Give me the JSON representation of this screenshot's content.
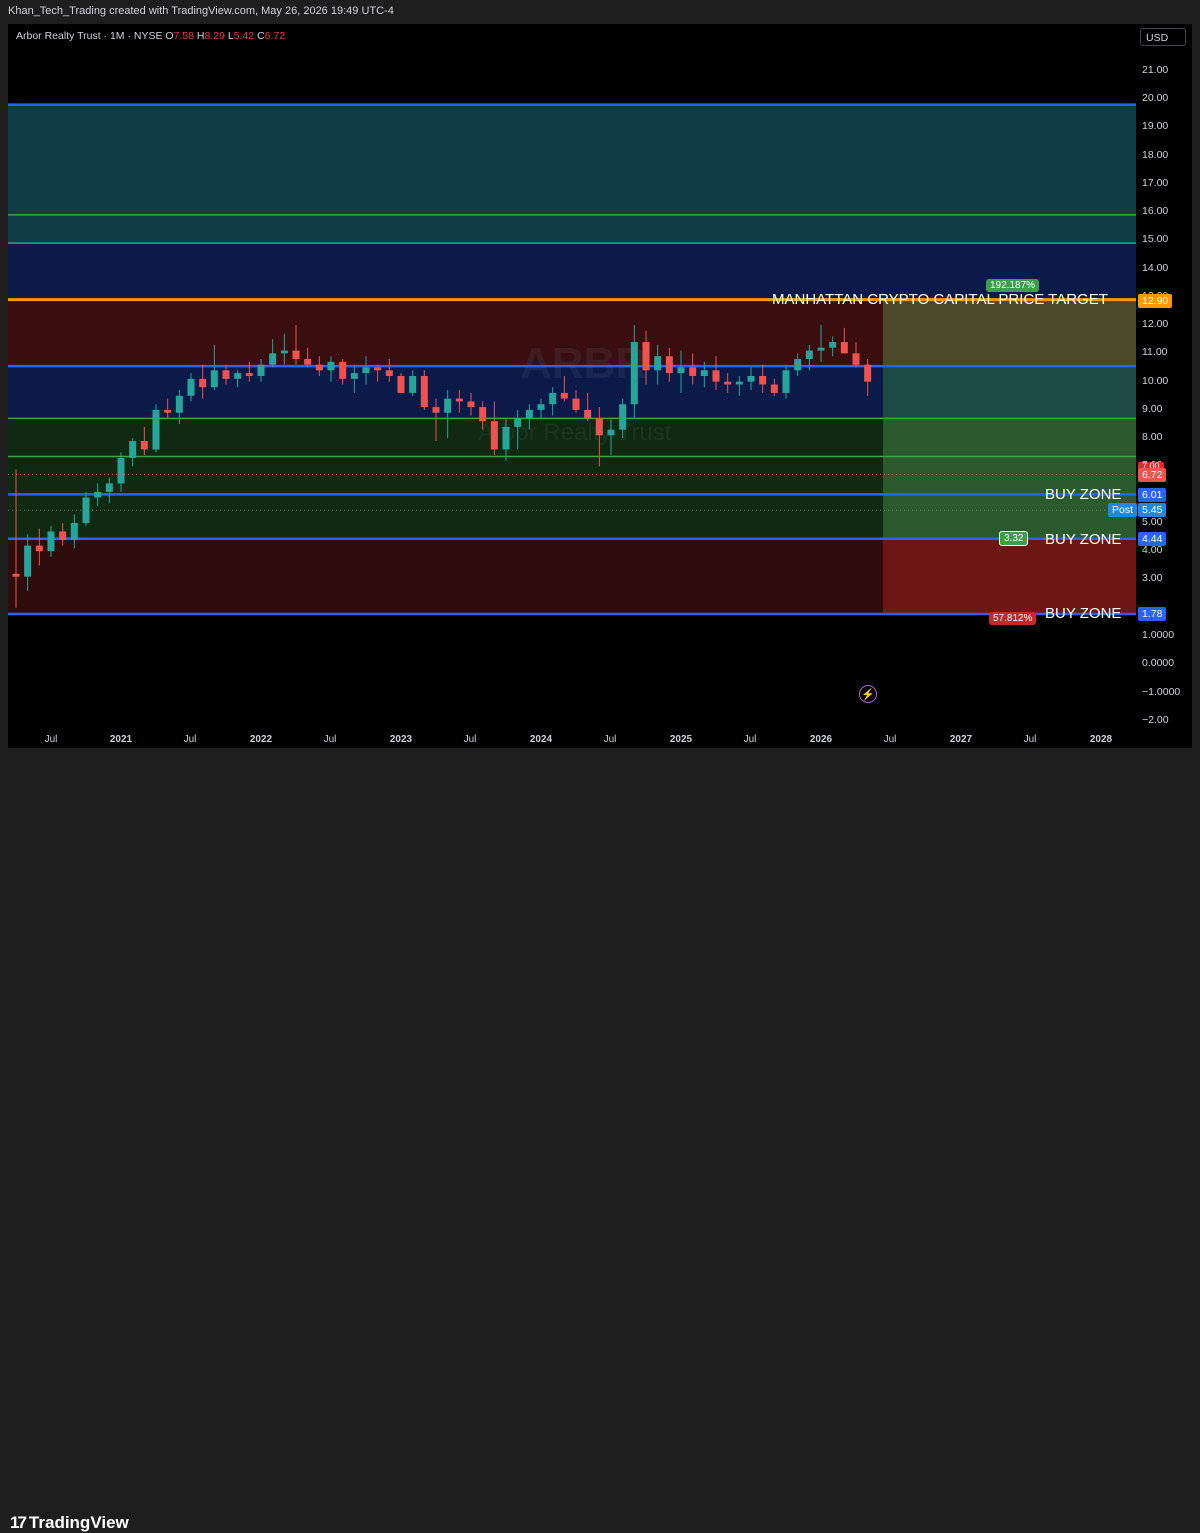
{
  "header": {
    "attribution": "Khan_Tech_Trading created with TradingView.com, May 26, 2026 19:49 UTC-4"
  },
  "legend": {
    "title": "Arbor Realty Trust · 1M · NYSE",
    "o": "7.58",
    "h": "8.29",
    "l": "5.42",
    "c": "6.72"
  },
  "currency": "USD",
  "watermark": {
    "ticker": "ARBR",
    "name": "Arbor Realty Trust"
  },
  "footer": {
    "brand": "TradingView"
  },
  "colors": {
    "up": "#26a69a",
    "down": "#ef5350",
    "blue_line": "#2962ff",
    "orange_line": "#ff9800",
    "green_line": "#43a047"
  },
  "annotations": {
    "target_label": "MANHATTAN CRYPTO CAPITAL PRICE TARGET",
    "buy_zone_1": "BUY ZONE",
    "buy_zone_2": "BUY ZONE",
    "buy_zone_3": "BUY ZONE",
    "gain_pct": "192.187%",
    "loss_pct": "57.812%",
    "ratio": "3.32"
  },
  "price_tags": {
    "target": "12.90",
    "last": "6.72",
    "buy1": "6.01",
    "post_label": "Post",
    "post_value": "5.45",
    "buy2": "4.44",
    "buy3": "1.78",
    "partial": "7.00"
  },
  "chart_data": {
    "type": "candlestick",
    "title": "Arbor Realty Trust · 1M · NYSE",
    "y_ticks": [
      "21.00",
      "20.00",
      "19.00",
      "18.00",
      "17.00",
      "16.00",
      "15.00",
      "14.00",
      "13.00",
      "12.00",
      "11.00",
      "10.00",
      "9.00",
      "8.00",
      "7.00",
      "5.00",
      "4.00",
      "3.00",
      "1.0000",
      "0.0000",
      "−1.0000",
      "−2.00"
    ],
    "x_ticks": [
      "Jul",
      "2021",
      "Jul",
      "2022",
      "Jul",
      "2023",
      "Jul",
      "2024",
      "Jul",
      "2025",
      "Jul",
      "2026",
      "Jul",
      "2027",
      "Jul",
      "2028"
    ],
    "ylim": [
      -2.2,
      22.3
    ],
    "horizontal_levels": [
      {
        "price": 19.8,
        "style": "blue"
      },
      {
        "price": 15.9,
        "style": "green"
      },
      {
        "price": 14.9,
        "style": "teal"
      },
      {
        "price": 12.9,
        "style": "orange"
      },
      {
        "price": 10.55,
        "style": "blue"
      },
      {
        "price": 8.7,
        "style": "green"
      },
      {
        "price": 7.35,
        "style": "green"
      },
      {
        "price": 6.01,
        "style": "blue"
      },
      {
        "price": 4.44,
        "style": "blue"
      },
      {
        "price": 1.78,
        "style": "blue"
      }
    ],
    "candles": [
      {
        "t": "2020-04",
        "o": 3.2,
        "h": 6.9,
        "l": 2.0,
        "c": 3.1
      },
      {
        "t": "2020-05",
        "o": 3.1,
        "h": 4.6,
        "l": 2.6,
        "c": 4.2
      },
      {
        "t": "2020-06",
        "o": 4.2,
        "h": 4.8,
        "l": 3.5,
        "c": 4.0
      },
      {
        "t": "2020-07",
        "o": 4.0,
        "h": 4.9,
        "l": 3.8,
        "c": 4.7
      },
      {
        "t": "2020-08",
        "o": 4.7,
        "h": 5.0,
        "l": 4.2,
        "c": 4.4
      },
      {
        "t": "2020-09",
        "o": 4.4,
        "h": 5.3,
        "l": 4.1,
        "c": 5.0
      },
      {
        "t": "2020-10",
        "o": 5.0,
        "h": 6.1,
        "l": 4.9,
        "c": 5.9
      },
      {
        "t": "2020-11",
        "o": 5.9,
        "h": 6.4,
        "l": 5.6,
        "c": 6.1
      },
      {
        "t": "2020-12",
        "o": 6.1,
        "h": 6.6,
        "l": 5.7,
        "c": 6.4
      },
      {
        "t": "2021-01",
        "o": 6.4,
        "h": 7.5,
        "l": 6.1,
        "c": 7.3
      },
      {
        "t": "2021-02",
        "o": 7.3,
        "h": 8.0,
        "l": 7.0,
        "c": 7.9
      },
      {
        "t": "2021-03",
        "o": 7.9,
        "h": 8.4,
        "l": 7.4,
        "c": 7.6
      },
      {
        "t": "2021-04",
        "o": 7.6,
        "h": 9.2,
        "l": 7.5,
        "c": 9.0
      },
      {
        "t": "2021-05",
        "o": 9.0,
        "h": 9.4,
        "l": 8.7,
        "c": 8.9
      },
      {
        "t": "2021-06",
        "o": 8.9,
        "h": 9.7,
        "l": 8.5,
        "c": 9.5
      },
      {
        "t": "2021-07",
        "o": 9.5,
        "h": 10.3,
        "l": 9.3,
        "c": 10.1
      },
      {
        "t": "2021-08",
        "o": 10.1,
        "h": 10.6,
        "l": 9.4,
        "c": 9.8
      },
      {
        "t": "2021-09",
        "o": 9.8,
        "h": 11.3,
        "l": 9.7,
        "c": 10.4
      },
      {
        "t": "2021-10",
        "o": 10.4,
        "h": 10.6,
        "l": 9.9,
        "c": 10.1
      },
      {
        "t": "2021-11",
        "o": 10.1,
        "h": 10.4,
        "l": 9.8,
        "c": 10.3
      },
      {
        "t": "2021-12",
        "o": 10.3,
        "h": 10.7,
        "l": 10.0,
        "c": 10.2
      },
      {
        "t": "2022-01",
        "o": 10.2,
        "h": 10.8,
        "l": 10.0,
        "c": 10.6
      },
      {
        "t": "2022-02",
        "o": 10.6,
        "h": 11.5,
        "l": 10.5,
        "c": 11.0
      },
      {
        "t": "2022-03",
        "o": 11.0,
        "h": 11.7,
        "l": 10.6,
        "c": 11.1
      },
      {
        "t": "2022-04",
        "o": 11.1,
        "h": 12.0,
        "l": 10.6,
        "c": 10.8
      },
      {
        "t": "2022-05",
        "o": 10.8,
        "h": 11.2,
        "l": 10.5,
        "c": 10.6
      },
      {
        "t": "2022-06",
        "o": 10.6,
        "h": 10.9,
        "l": 10.2,
        "c": 10.4
      },
      {
        "t": "2022-07",
        "o": 10.4,
        "h": 10.9,
        "l": 10.0,
        "c": 10.7
      },
      {
        "t": "2022-08",
        "o": 10.7,
        "h": 10.8,
        "l": 9.9,
        "c": 10.1
      },
      {
        "t": "2022-09",
        "o": 10.1,
        "h": 10.6,
        "l": 9.6,
        "c": 10.3
      },
      {
        "t": "2022-10",
        "o": 10.3,
        "h": 10.9,
        "l": 9.9,
        "c": 10.5
      },
      {
        "t": "2022-11",
        "o": 10.5,
        "h": 10.6,
        "l": 10.0,
        "c": 10.4
      },
      {
        "t": "2022-12",
        "o": 10.4,
        "h": 10.8,
        "l": 10.0,
        "c": 10.2
      },
      {
        "t": "2023-01",
        "o": 10.2,
        "h": 10.3,
        "l": 9.6,
        "c": 9.6
      },
      {
        "t": "2023-02",
        "o": 9.6,
        "h": 10.4,
        "l": 9.5,
        "c": 10.2
      },
      {
        "t": "2023-03",
        "o": 10.2,
        "h": 10.4,
        "l": 9.0,
        "c": 9.1
      },
      {
        "t": "2023-04",
        "o": 9.1,
        "h": 9.4,
        "l": 7.9,
        "c": 8.9
      },
      {
        "t": "2023-05",
        "o": 8.9,
        "h": 9.7,
        "l": 8.0,
        "c": 9.4
      },
      {
        "t": "2023-06",
        "o": 9.4,
        "h": 9.7,
        "l": 8.9,
        "c": 9.3
      },
      {
        "t": "2023-07",
        "o": 9.3,
        "h": 9.6,
        "l": 8.8,
        "c": 9.1
      },
      {
        "t": "2023-08",
        "o": 9.1,
        "h": 9.3,
        "l": 8.3,
        "c": 8.6
      },
      {
        "t": "2023-09",
        "o": 8.6,
        "h": 9.3,
        "l": 7.4,
        "c": 7.6
      },
      {
        "t": "2023-10",
        "o": 7.6,
        "h": 8.7,
        "l": 7.2,
        "c": 8.4
      },
      {
        "t": "2023-11",
        "o": 8.4,
        "h": 9.0,
        "l": 7.6,
        "c": 8.7
      },
      {
        "t": "2023-12",
        "o": 8.7,
        "h": 9.2,
        "l": 8.3,
        "c": 9.0
      },
      {
        "t": "2024-01",
        "o": 9.0,
        "h": 9.4,
        "l": 8.7,
        "c": 9.2
      },
      {
        "t": "2024-02",
        "o": 9.2,
        "h": 9.8,
        "l": 8.8,
        "c": 9.6
      },
      {
        "t": "2024-03",
        "o": 9.6,
        "h": 10.2,
        "l": 9.3,
        "c": 9.4
      },
      {
        "t": "2024-04",
        "o": 9.4,
        "h": 9.7,
        "l": 8.9,
        "c": 9.0
      },
      {
        "t": "2024-05",
        "o": 9.0,
        "h": 9.6,
        "l": 8.6,
        "c": 8.7
      },
      {
        "t": "2024-06",
        "o": 8.7,
        "h": 9.1,
        "l": 7.0,
        "c": 8.1
      },
      {
        "t": "2024-07",
        "o": 8.1,
        "h": 8.7,
        "l": 7.4,
        "c": 8.3
      },
      {
        "t": "2024-08",
        "o": 8.3,
        "h": 9.4,
        "l": 8.0,
        "c": 9.2
      },
      {
        "t": "2024-09",
        "o": 9.2,
        "h": 12.0,
        "l": 8.7,
        "c": 11.4
      },
      {
        "t": "2024-10",
        "o": 11.4,
        "h": 11.8,
        "l": 9.9,
        "c": 10.4
      },
      {
        "t": "2024-11",
        "o": 10.4,
        "h": 11.3,
        "l": 9.9,
        "c": 10.9
      },
      {
        "t": "2024-12",
        "o": 10.9,
        "h": 11.2,
        "l": 10.0,
        "c": 10.3
      },
      {
        "t": "2025-01",
        "o": 10.3,
        "h": 11.1,
        "l": 9.6,
        "c": 10.5
      },
      {
        "t": "2025-02",
        "o": 10.5,
        "h": 11.0,
        "l": 9.9,
        "c": 10.2
      },
      {
        "t": "2025-03",
        "o": 10.2,
        "h": 10.7,
        "l": 9.8,
        "c": 10.4
      },
      {
        "t": "2025-04",
        "o": 10.4,
        "h": 10.9,
        "l": 9.7,
        "c": 10.0
      },
      {
        "t": "2025-05",
        "o": 10.0,
        "h": 10.3,
        "l": 9.6,
        "c": 9.9
      },
      {
        "t": "2025-06",
        "o": 9.9,
        "h": 10.2,
        "l": 9.5,
        "c": 10.0
      },
      {
        "t": "2025-07",
        "o": 10.0,
        "h": 10.5,
        "l": 9.7,
        "c": 10.2
      },
      {
        "t": "2025-08",
        "o": 10.2,
        "h": 10.6,
        "l": 9.6,
        "c": 9.9
      },
      {
        "t": "2025-09",
        "o": 9.9,
        "h": 10.1,
        "l": 9.5,
        "c": 9.6
      },
      {
        "t": "2025-10",
        "o": 9.6,
        "h": 10.6,
        "l": 9.4,
        "c": 10.4
      },
      {
        "t": "2025-11",
        "o": 10.4,
        "h": 11.0,
        "l": 10.2,
        "c": 10.8
      },
      {
        "t": "2025-12",
        "o": 10.8,
        "h": 11.3,
        "l": 10.4,
        "c": 11.1
      },
      {
        "t": "2026-01",
        "o": 11.1,
        "h": 12.0,
        "l": 10.7,
        "c": 11.2
      },
      {
        "t": "2026-02",
        "o": 11.2,
        "h": 11.6,
        "l": 10.9,
        "c": 11.4
      },
      {
        "t": "2026-03",
        "o": 11.4,
        "h": 11.9,
        "l": 11.0,
        "c": 11.0
      },
      {
        "t": "2026-04",
        "o": 11.0,
        "h": 11.4,
        "l": 10.5,
        "c": 10.6
      },
      {
        "t": "2026-05",
        "o": 10.6,
        "h": 10.8,
        "l": 9.5,
        "c": 10.0
      }
    ]
  }
}
